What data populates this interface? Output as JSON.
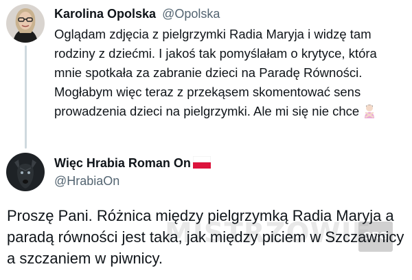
{
  "tweet1": {
    "name": "Karolina Opolska",
    "handle": "@Opolska",
    "text": "Oglądam zdjęcia z pielgrzymki Radia Maryja i widzę tam rodziny z dziećmi. I jakoś tak pomyślałam o krytyce, która mnie spotkała za zabranie dzieci na Paradę Równości. Mogłabym więc teraz z przekąsem skomentować sens prowadzenia dzieci na pielgrzymki. Ale mi się nie chce",
    "emoji": "woman-gesturing-no-emoji"
  },
  "tweet2": {
    "name": "Więc Hrabia Roman On",
    "flag": "poland-flag",
    "handle": "@HrabiaOn",
    "text": "Proszę Pani. Różnica między pielgrzymką Radia Maryja a paradą równości jest taka, jak między piciem w Szczawnicy a szczaniem w piwnicy."
  },
  "watermark": {
    "text": "MISTRZOWIE",
    "suffix": "ORG"
  },
  "colors": {
    "text": "#0f1419",
    "secondary": "#536471",
    "thread_line": "#cfd9de",
    "flag_white": "#ffffff",
    "flag_red": "#dc143c"
  }
}
